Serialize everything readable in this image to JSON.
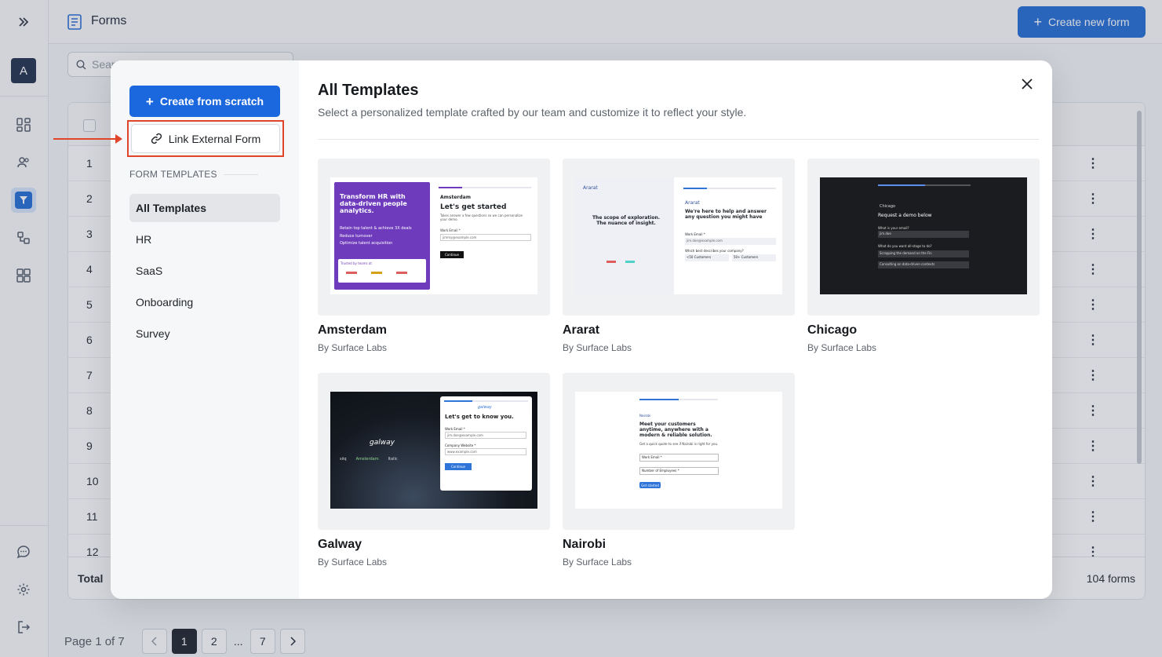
{
  "background": {
    "topbar": {
      "title": "Forms",
      "create_button": "Create new form"
    },
    "search": {
      "placeholder": "Search"
    },
    "table": {
      "rows": [
        "1",
        "2",
        "3",
        "4",
        "5",
        "6",
        "7",
        "8",
        "9",
        "10",
        "11",
        "12"
      ],
      "footer_total": "Total",
      "footer_count": "104 forms"
    },
    "pager": {
      "label": "Page 1 of 7",
      "pages": [
        "1",
        "2",
        "...",
        "7"
      ]
    },
    "rail": {
      "avatar": "A"
    }
  },
  "modal": {
    "create_scratch": "Create from scratch",
    "link_external": "Link External Form",
    "section_heading": "FORM TEMPLATES",
    "categories": [
      "All Templates",
      "HR",
      "SaaS",
      "Onboarding",
      "Survey"
    ],
    "title": "All Templates",
    "subtitle": "Select a personalized template crafted by our team and customize it to reflect your style.",
    "templates": [
      {
        "name": "Amsterdam",
        "by": "By Surface Labs",
        "preview": {
          "headline": "Transform HR with data-driven people analytics.",
          "bullets": [
            "Retain top talent & achieve 3X deals",
            "Reduce turnover",
            "Optimize talent acquisition"
          ],
          "trusted": "Trusted by teams at",
          "brand": "Amsterdam",
          "form_title": "Let's get started",
          "form_desc": "Takes answer a few questions so we can personalize your demo.",
          "field_label": "Work Email *",
          "field_value": "jimmy@example.com",
          "button": "Continue"
        }
      },
      {
        "name": "Ararat",
        "by": "By Surface Labs",
        "preview": {
          "brand": "Ararat",
          "left_title": "The scope of exploration. The nuance of insight.",
          "form_title": "We're here to help and answer any question you might have",
          "field_label": "Work Email *",
          "field_value": "jim.doe@example.com",
          "question": "Which best describes your company?",
          "opt1": "<50 Customers",
          "opt2": "50+ Customers"
        }
      },
      {
        "name": "Chicago",
        "by": "By Surface Labs",
        "preview": {
          "brand": "Chicago",
          "form_title": "Request a demo below",
          "q1": "What is your email?",
          "v1": "jim.doe",
          "q2": "What do you want all-stage to do?",
          "o1": "Scrapping the demand on the Fin",
          "o2": "Consulting on data-driven contexts"
        }
      },
      {
        "name": "Galway",
        "by": "By Surface Labs",
        "preview": {
          "brand": "galway",
          "logos": [
            "siiq",
            "Amsterdam",
            "Italic"
          ],
          "form_title": "Let's get to know you.",
          "field_label": "Work Email *",
          "field_value": "jim.doe@example.com",
          "field2_label": "Company Website *",
          "field2_value": "www.example.com",
          "button": "Continue"
        }
      },
      {
        "name": "Nairobi",
        "by": "By Surface Labs",
        "preview": {
          "brand": "Nairobi",
          "form_title": "Meet your customers anytime, anywhere with a modern & reliable solution.",
          "desc": "Get a quick quote to see if Nairobi is right for you.",
          "f1": "Work Email *",
          "f2": "Number of Employees *",
          "button": "Get started"
        }
      }
    ]
  },
  "colors": {
    "primary": "#1a67de",
    "highlight": "#e0452a",
    "purple": "#6f3bbd",
    "dark": "#1b1c1f"
  }
}
